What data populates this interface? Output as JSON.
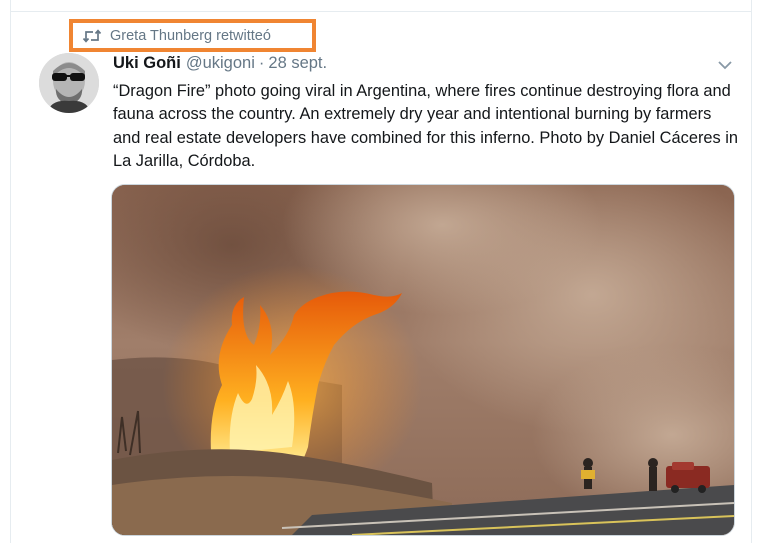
{
  "retweet": {
    "label": "Greta Thunberg retwitteó",
    "icon": "retweet-icon"
  },
  "tweet": {
    "author_name": "Uki Goñi",
    "author_handle": "@ukigoni",
    "separator": "·",
    "date": "28 sept.",
    "text": "“Dragon Fire” photo going viral in Argentina, where fires continue destroying flora and fauna across the country. An extremely dry year and intentional burning by farmers and real estate developers have combined for this inferno. Photo by Daniel Cáceres in La Jarilla, Córdoba.",
    "menu_icon": "chevron-down-icon"
  },
  "colors": {
    "highlight_border": "#f08532",
    "secondary_text": "#657786",
    "primary_text": "#14171a"
  }
}
